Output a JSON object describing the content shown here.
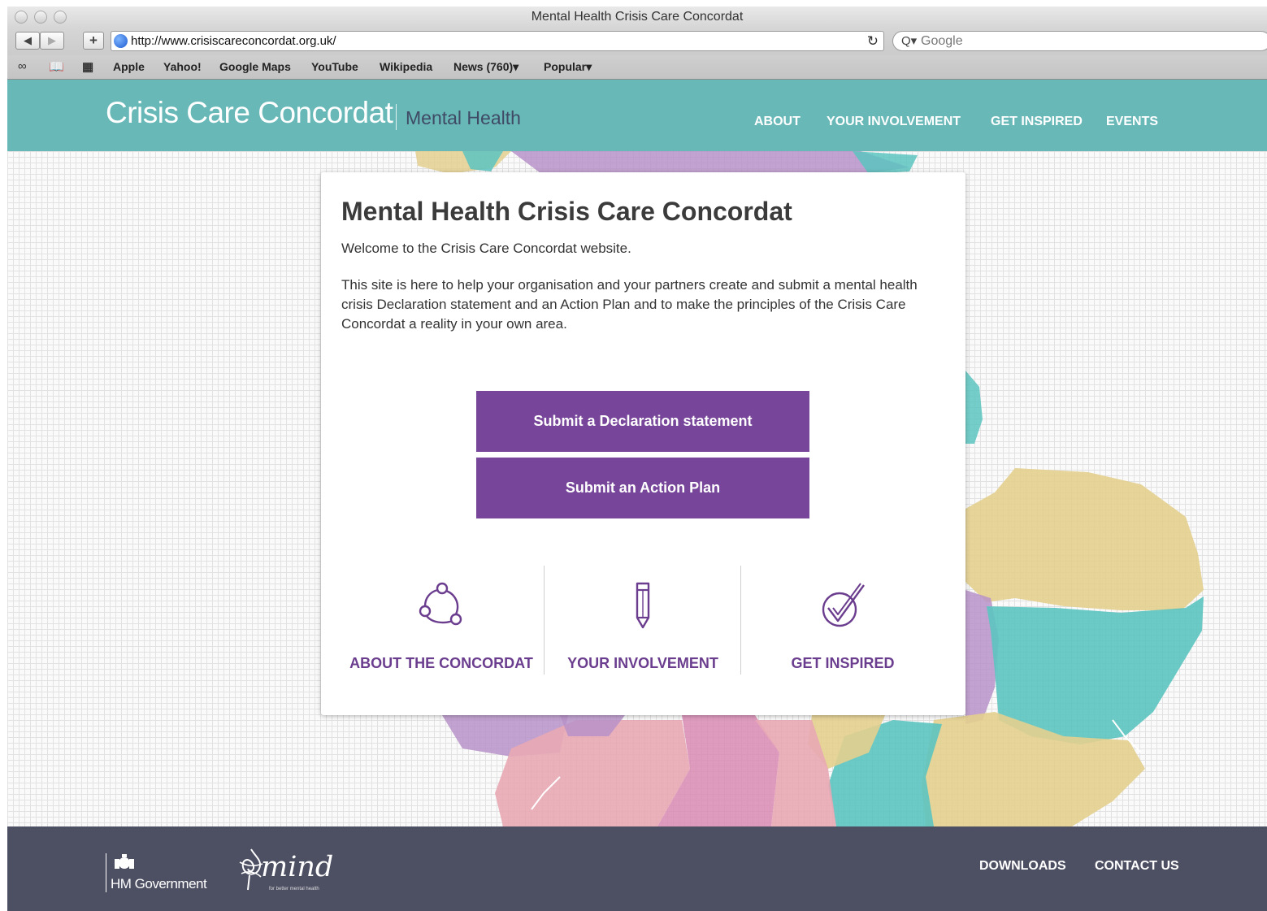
{
  "browser": {
    "window_title": "Mental Health Crisis Care Concordat",
    "back_icon": "back-arrow-icon",
    "forward_icon": "forward-arrow-icon",
    "add_icon": "plus-icon",
    "url": "http://www.crisiscareconcordat.org.uk/",
    "reload_icon": "reload-icon",
    "search_placeholder": "Google",
    "bookmarks": [
      "Apple",
      "Yahoo!",
      "Google Maps",
      "YouTube",
      "Wikipedia",
      "News (760)▾",
      "Popular▾"
    ]
  },
  "header": {
    "logo_main": "Crisis Care Concordat",
    "logo_sub": "Mental Health",
    "nav": [
      "ABOUT",
      "YOUR INVOLVEMENT",
      "GET INSPIRED",
      "EVENTS"
    ]
  },
  "card": {
    "title": "Mental Health Crisis Care Concordat",
    "welcome": "Welcome to the Crisis Care Concordat website.",
    "body": "This site is here to help your organisation and your partners create and submit a mental health crisis Declaration statement and an Action Plan and to make the principles of the Crisis Care Concordat a reality in your own area.",
    "buttons": [
      "Submit a Declaration statement",
      "Submit an Action Plan"
    ],
    "features": [
      {
        "label": "ABOUT THE CONCORDAT",
        "icon": "network-nodes-icon"
      },
      {
        "label": "YOUR INVOLVEMENT",
        "icon": "pencil-icon"
      },
      {
        "label": "GET INSPIRED",
        "icon": "checkmark-icon"
      }
    ]
  },
  "footer": {
    "hm_government": "HM Government",
    "mind_logo": "mind",
    "mind_tagline": "for better mental health",
    "links": [
      "DOWNLOADS",
      "CONTACT US"
    ]
  },
  "colors": {
    "header_teal": "#68b8b8",
    "button_purple": "#77469a",
    "footer_slate": "#4d4f63",
    "map_teal": "#5cc4c0",
    "map_sand": "#e3cf8e",
    "map_purple": "#b792c8",
    "map_pink": "#e8a8b4"
  }
}
